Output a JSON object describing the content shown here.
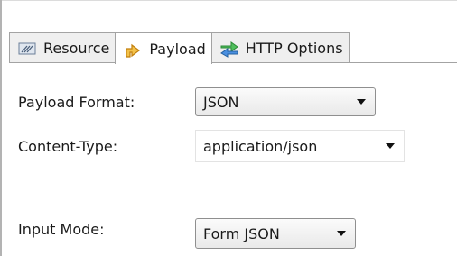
{
  "tabs": [
    {
      "label": "Resource",
      "icon": "resource-icon",
      "active": false
    },
    {
      "label": "Payload",
      "icon": "payload-icon",
      "active": true
    },
    {
      "label": "HTTP Options",
      "icon": "http-options-icon",
      "active": false
    }
  ],
  "form": {
    "payload_format": {
      "label": "Payload Format:",
      "value": "JSON"
    },
    "content_type": {
      "label": "Content-Type:",
      "value": "application/json"
    },
    "input_mode": {
      "label": "Input Mode:",
      "value": "Form JSON"
    }
  },
  "colors": {
    "payload_icon": "#e8a21b",
    "http_icon_a": "#3aa54a",
    "http_icon_b": "#2f6fc7"
  }
}
